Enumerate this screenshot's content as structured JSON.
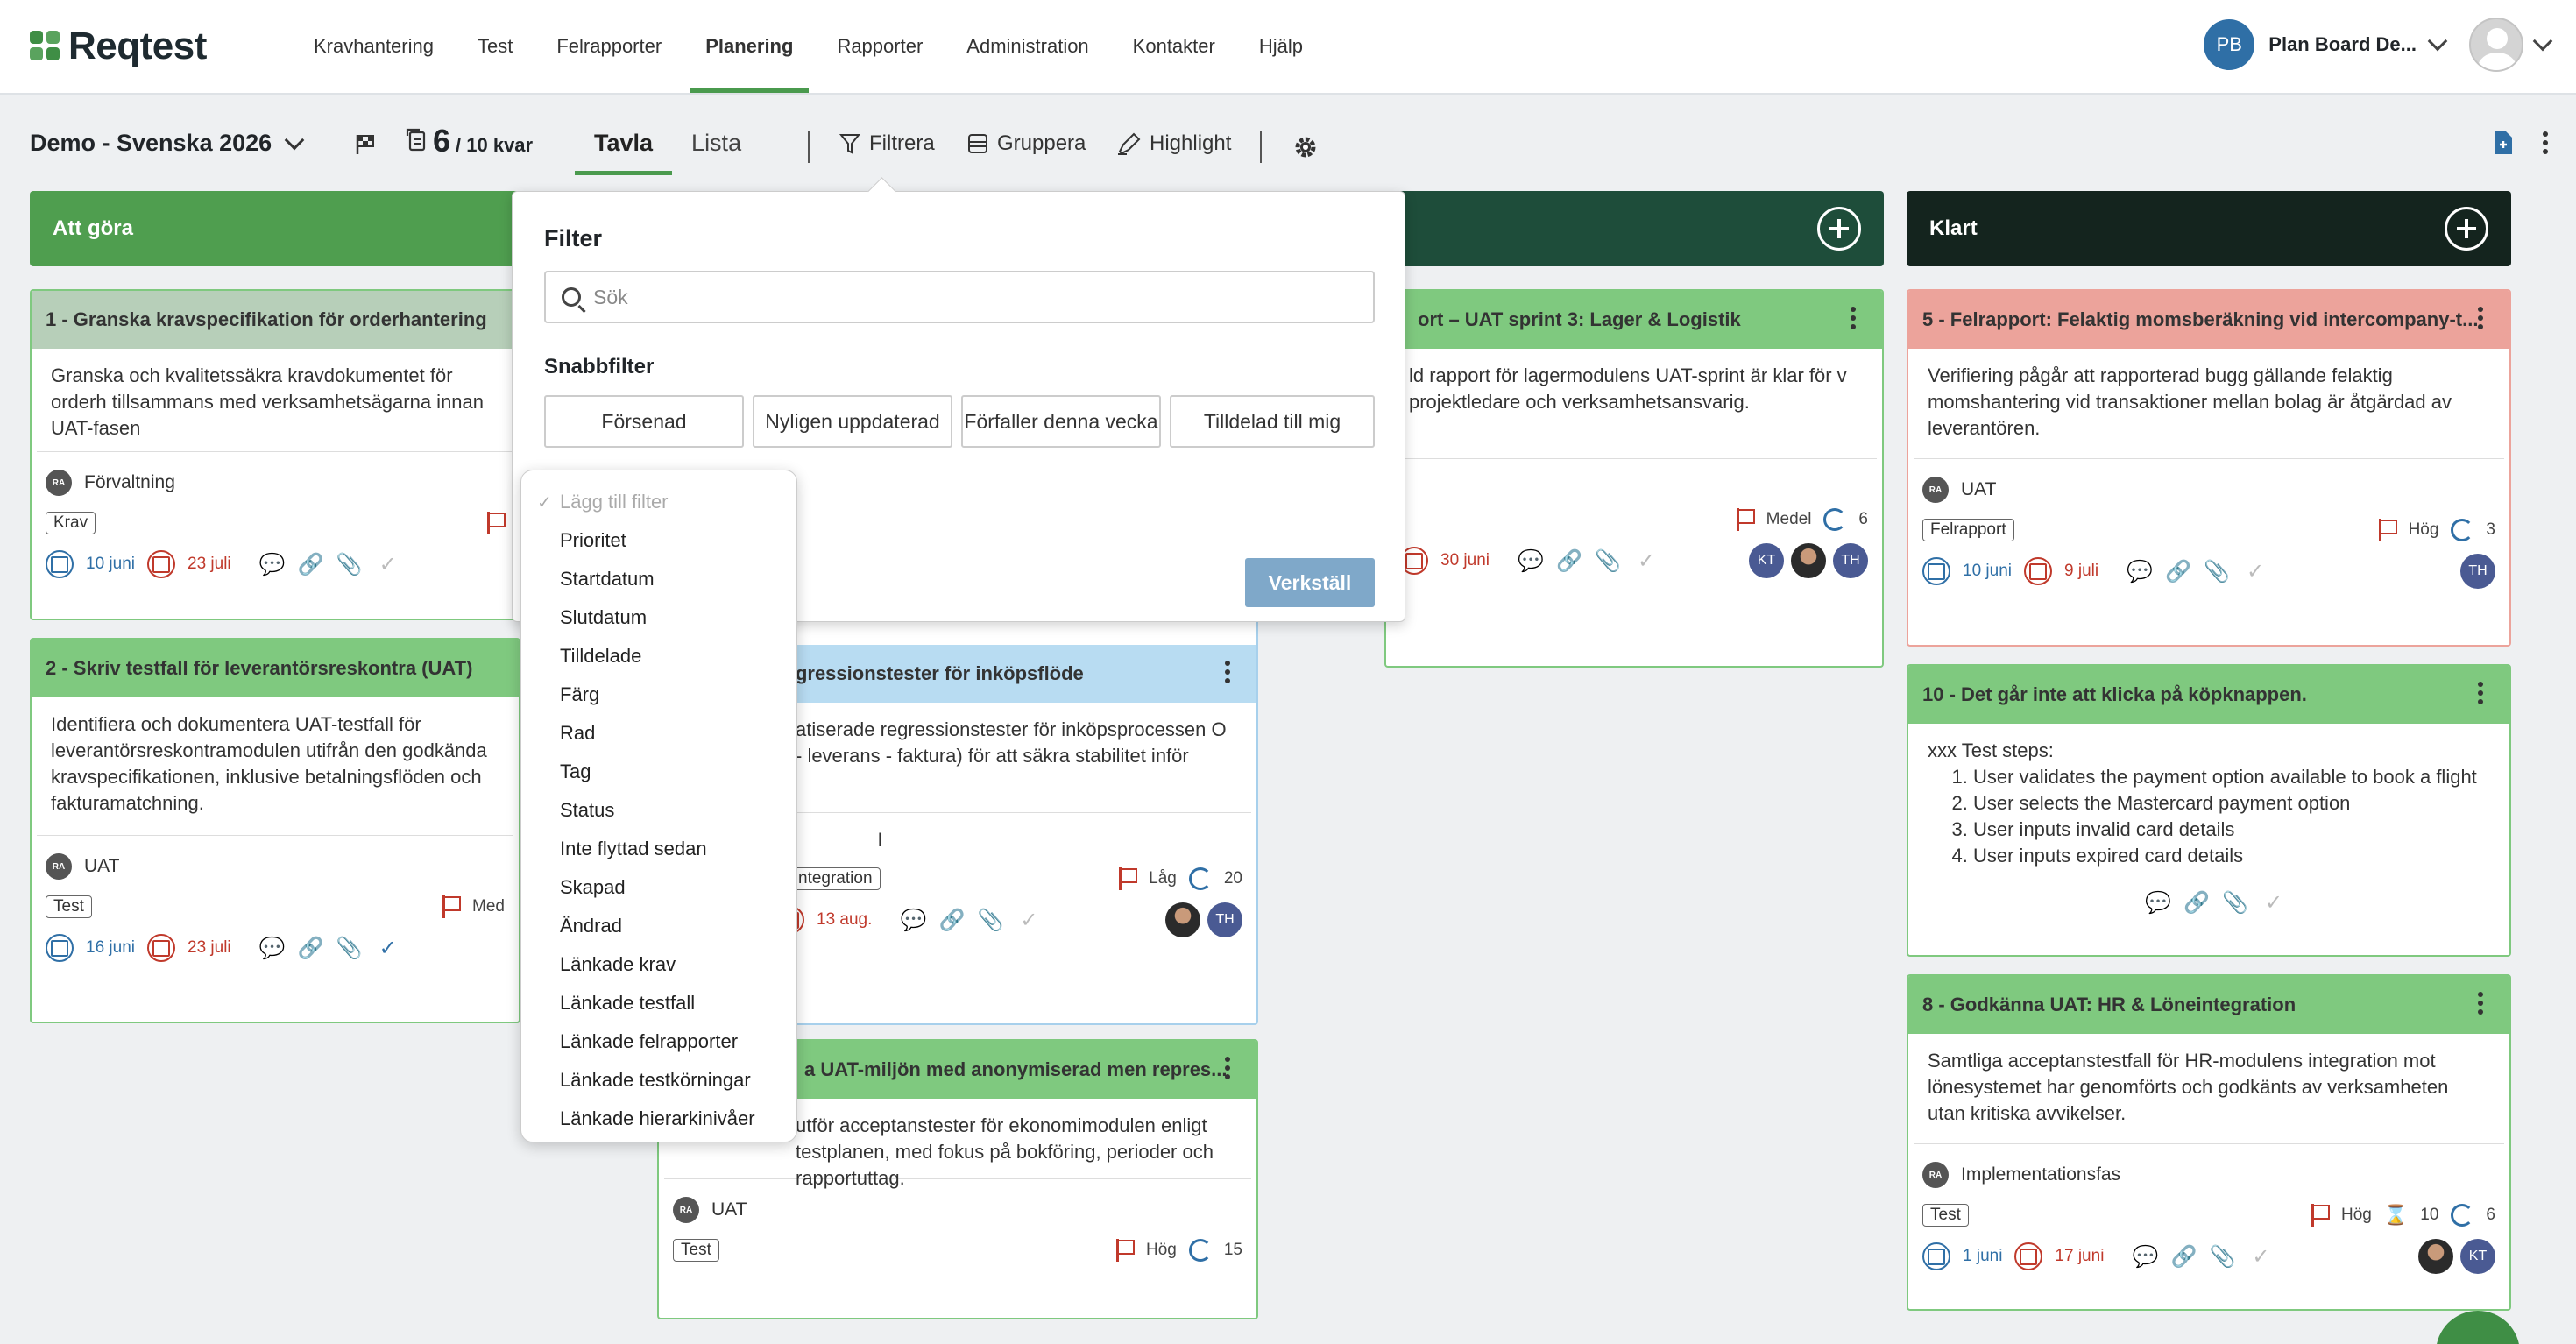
{
  "app": {
    "logo_text": "Reqtest"
  },
  "nav": {
    "items": [
      {
        "label": "Kravhantering",
        "active": false
      },
      {
        "label": "Test",
        "active": false
      },
      {
        "label": "Felrapporter",
        "active": false
      },
      {
        "label": "Planering",
        "active": true
      },
      {
        "label": "Rapporter",
        "active": false
      },
      {
        "label": "Administration",
        "active": false
      },
      {
        "label": "Kontakter",
        "active": false
      },
      {
        "label": "Hjälp",
        "active": false
      }
    ],
    "user_initials": "PB",
    "user_label": "Plan Board De..."
  },
  "toolbar": {
    "board_title": "Demo - Svenska 2026",
    "count_done": "6",
    "count_rest": "/ 10 kvar",
    "tabs": [
      {
        "label": "Tavla",
        "active": true
      },
      {
        "label": "Lista",
        "active": false
      }
    ],
    "filter_label": "Filtrera",
    "group_label": "Gruppera",
    "highlight_label": "Highlight"
  },
  "columns": [
    {
      "title": "Att göra",
      "color": "#4f9e4f"
    },
    {
      "title": "",
      "color": "#1e4d3a"
    },
    {
      "title": "Klart",
      "color": "#14241e"
    }
  ],
  "cards": {
    "c1": {
      "title": "1 - Granska kravspecifikation för orderhantering",
      "desc": "Granska och kvalitetssäkra kravdokumentet för orderh tillsammans med verksamhetsägarna innan UAT-fasen",
      "ra": "RA",
      "category": "Förvaltning",
      "tag": "Krav",
      "start": "10 juni",
      "end": "23 juli"
    },
    "c2": {
      "title": "2 - Skriv testfall för leverantörsreskontra (UAT)",
      "desc": "Identifiera och dokumentera UAT-testfall för leverantörsreskontramodulen utifrån den godkända kravspecifikationen, inklusive betalningsflöden och fakturamatchning.",
      "ra": "RA",
      "category": "UAT",
      "tag": "Test",
      "priority": "Med",
      "start": "16 juni",
      "end": "23 juli"
    },
    "c3": {
      "title": "era regressionstester för inköpsflöde",
      "desc": "atiserade regressionstester för inköpsprocessen O - leverans - faktura) för att säkra stabilitet inför",
      "category": "l",
      "tag": "ntegration",
      "priority": "Låg",
      "count": "20",
      "end": "13 aug.",
      "assignee": "TH"
    },
    "c4": {
      "title": "a UAT-miljön med anonymiserad men repres...",
      "desc": "utför acceptanstester för ekonomimodulen enligt testplanen, med fokus på bokföring, perioder och rapportuttag.",
      "ra": "RA",
      "category": "UAT",
      "tag": "Test",
      "priority": "Hög",
      "count": "15"
    },
    "c5": {
      "title": "ort – UAT sprint 3: Lager & Logistik",
      "desc": "ld rapport för lagermodulens UAT-sprint är klar för v projektledare och verksamhetsansvarig.",
      "priority": "Medel",
      "count": "6",
      "end": "30 juni",
      "assignees": [
        "KT",
        "",
        "TH"
      ]
    },
    "c6": {
      "title": "5 - Felrapport: Felaktig momsberäkning vid intercompany-t...",
      "desc": "Verifiering pågår att rapporterad bugg gällande felaktig momshantering vid transaktioner mellan bolag är åtgärdad av leverantören.",
      "ra": "RA",
      "category": "UAT",
      "tag": "Felrapport",
      "priority": "Hög",
      "count": "3",
      "start": "10 juni",
      "end": "9 juli",
      "assignee": "TH"
    },
    "c7": {
      "title": "10 - Det går inte att klicka på köpknappen.",
      "desc_lead": "xxx Test steps:",
      "steps": [
        "User validates the payment option available to book a flight",
        "User selects the Mastercard payment option",
        "User inputs invalid card details",
        "User inputs expired card details"
      ]
    },
    "c8": {
      "title": "8 - Godkänna UAT: HR & Löneintegration",
      "desc": "Samtliga acceptanstestfall för HR-modulens integration mot lönesystemet har genomförts och godkänts av verksamheten utan kritiska avvikelser.",
      "ra": "RA",
      "category": "Implementationsfas",
      "tag": "Test",
      "priority": "Hög",
      "hours": "10",
      "count": "6",
      "start": "1 juni",
      "end": "17 juni",
      "assignee": "KT"
    }
  },
  "filter": {
    "title": "Filter",
    "search_placeholder": "Sök",
    "quick_title": "Snabbfilter",
    "quick": [
      "Försenad",
      "Nyligen uppdaterad",
      "Förfaller denna vecka",
      "Tilldelad till mig"
    ],
    "apply": "Verkställ",
    "dropdown_placeholder": "Lägg till filter",
    "dropdown": [
      "Prioritet",
      "Startdatum",
      "Slutdatum",
      "Tilldelade",
      "Färg",
      "Rad",
      "Tag",
      "Status",
      "Inte flyttad sedan",
      "Skapad",
      "Ändrad",
      "Länkade krav",
      "Länkade testfall",
      "Länkade felrapporter",
      "Länkade testkörningar",
      "Länkade hierarkinivåer"
    ]
  }
}
